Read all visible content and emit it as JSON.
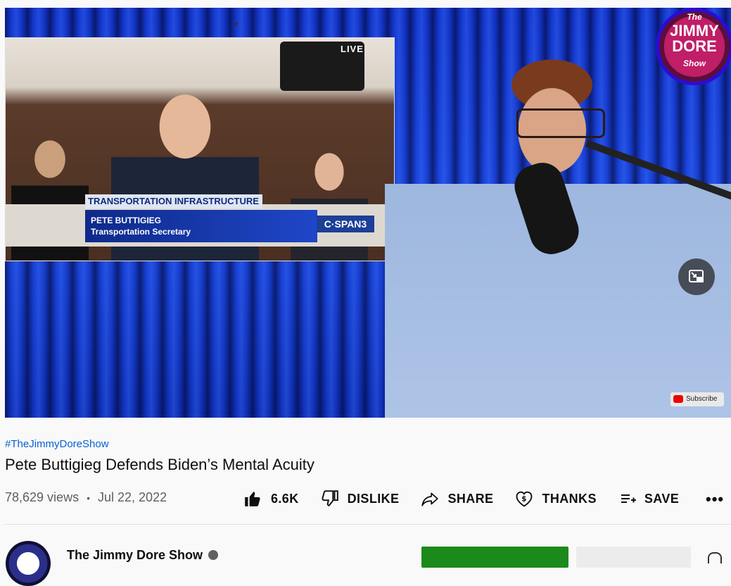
{
  "video": {
    "inset": {
      "live_label": "LIVE",
      "banner_top": "TRANSPORTATION INFRASTRUCTURE",
      "banner_name": "PETE BUTTIGIEG",
      "banner_role": "Transportation Secretary",
      "network": "C·SPAN3"
    },
    "logo": {
      "line1": "The",
      "line2": "JIMMY DORE",
      "line3": "Show"
    },
    "subscribe_watermark": "Subscribe"
  },
  "info": {
    "hashtag": "#TheJimmyDoreShow",
    "title": "Pete Buttigieg Defends Biden’s Mental Acuity",
    "views": "78,629 views",
    "separator": "•",
    "date": "Jul 22, 2022"
  },
  "actions": {
    "like_count": "6.6K",
    "dislike_label": "DISLIKE",
    "share_label": "SHARE",
    "thanks_label": "THANKS",
    "save_label": "SAVE",
    "more_label": "•••"
  },
  "channel": {
    "name": "The Jimmy Dore Show"
  },
  "colors": {
    "link": "#065fd4",
    "join_button": "#1b8a1b",
    "text_primary": "#0f0f0f",
    "text_secondary": "#606060"
  }
}
